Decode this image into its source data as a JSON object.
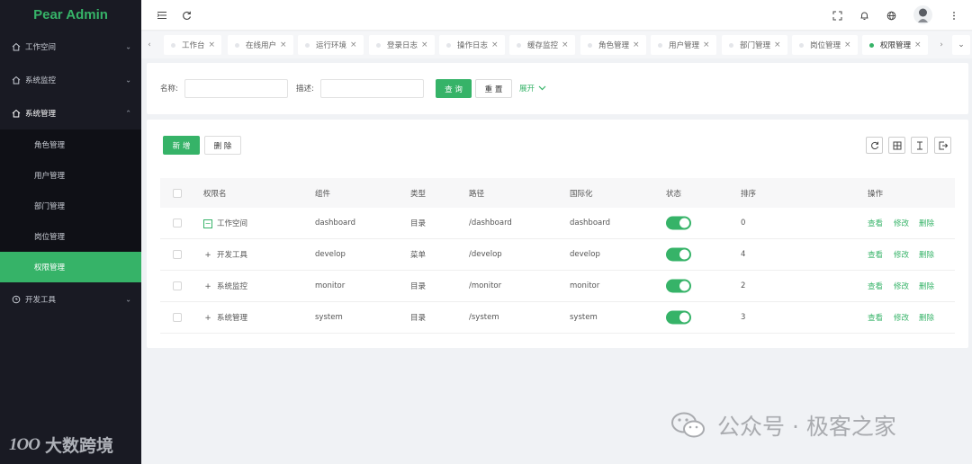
{
  "app": {
    "title": "Pear Admin",
    "brand_color": "#36b368"
  },
  "sidebar": {
    "menu": [
      {
        "label": "工作空间",
        "icon": "home-icon"
      },
      {
        "label": "系统监控",
        "icon": "home-icon"
      },
      {
        "label": "系统管理",
        "icon": "home-icon",
        "open": true
      },
      {
        "label": "开发工具",
        "icon": "clock-icon"
      }
    ],
    "submenu": [
      "角色管理",
      "用户管理",
      "部门管理",
      "岗位管理",
      "权限管理"
    ],
    "active_sub": "权限管理",
    "watermark": {
      "logo": "1OO",
      "text": "大数跨境"
    }
  },
  "tabs": [
    "工作台",
    "在线用户",
    "运行环境",
    "登录日志",
    "操作日志",
    "缓存监控",
    "角色管理",
    "用户管理",
    "部门管理",
    "岗位管理",
    "权限管理"
  ],
  "active_tab": "权限管理",
  "search": {
    "name_label": "名称:",
    "desc_label": "描述:",
    "name_value": "",
    "desc_value": "",
    "query_button": "查 询",
    "reset_button": "重 置",
    "expand_label": "展开"
  },
  "toolbar": {
    "add_button": "新 增",
    "delete_button": "删 除"
  },
  "table": {
    "headers": [
      "权限名",
      "组件",
      "类型",
      "路径",
      "国际化",
      "状态",
      "排序",
      "操作"
    ],
    "rows": [
      {
        "name": "工作空间",
        "component": "dashboard",
        "type": "目录",
        "path": "/dashboard",
        "i18n": "dashboard",
        "enabled": true,
        "order": "0",
        "expanded": true
      },
      {
        "name": "开发工具",
        "component": "develop",
        "type": "菜单",
        "path": "/develop",
        "i18n": "develop",
        "enabled": true,
        "order": "4",
        "expanded": false
      },
      {
        "name": "系统监控",
        "component": "monitor",
        "type": "目录",
        "path": "/monitor",
        "i18n": "monitor",
        "enabled": true,
        "order": "2",
        "expanded": false
      },
      {
        "name": "系统管理",
        "component": "system",
        "type": "目录",
        "path": "/system",
        "i18n": "system",
        "enabled": true,
        "order": "3",
        "expanded": false
      }
    ],
    "actions": [
      "查看",
      "修改",
      "删除"
    ]
  },
  "watermark_right": "公众号 · 极客之家"
}
